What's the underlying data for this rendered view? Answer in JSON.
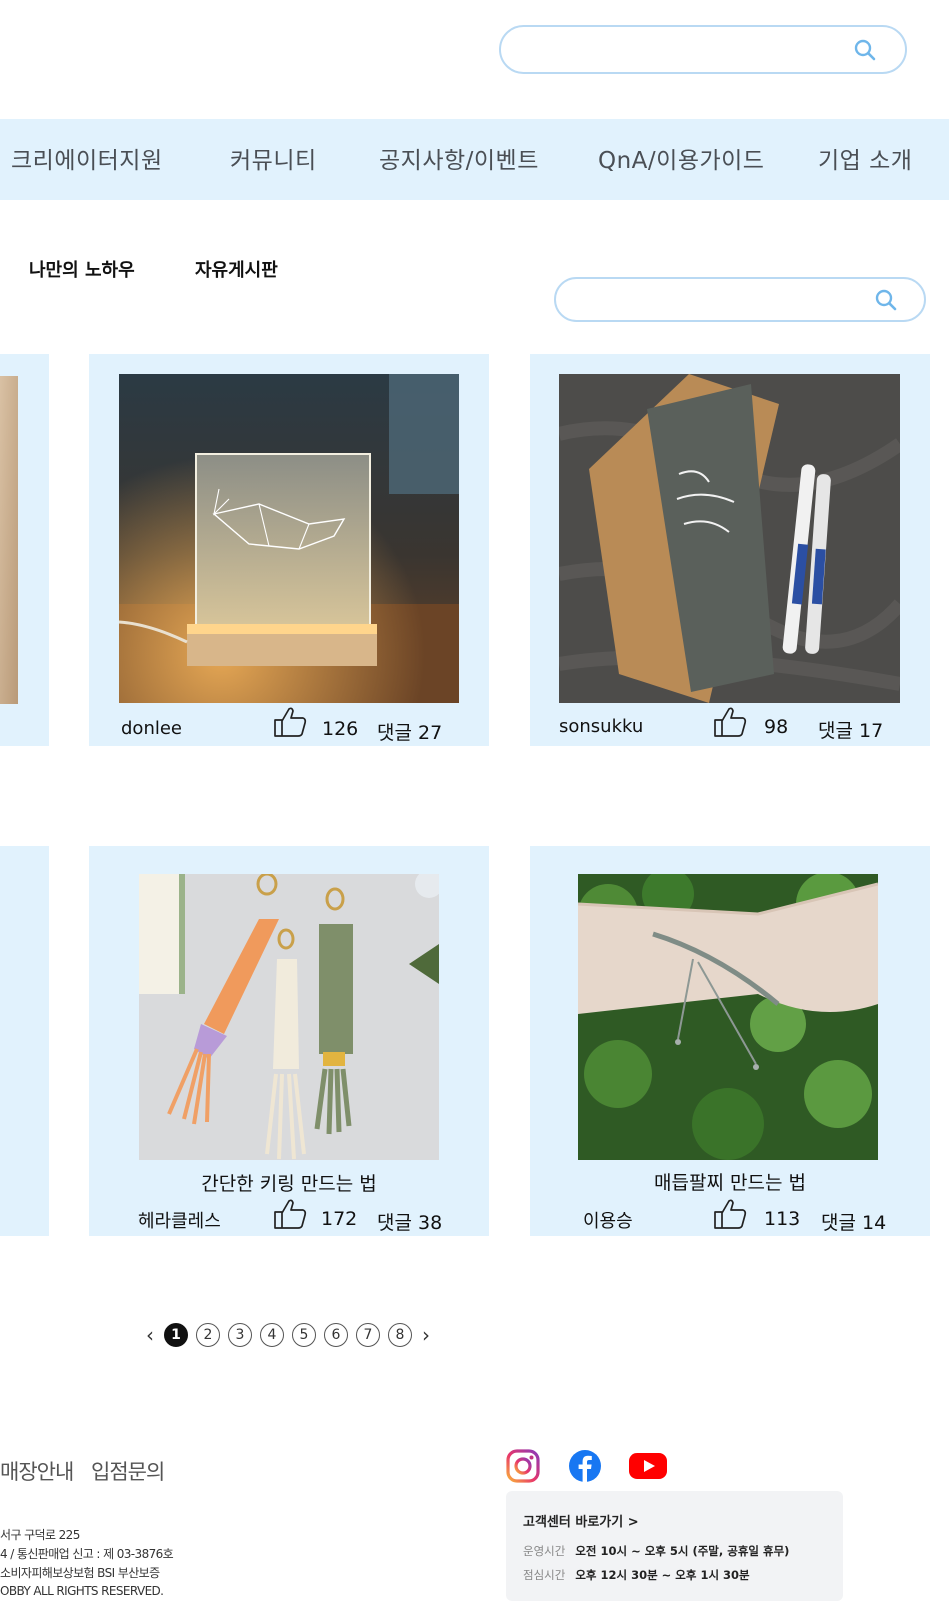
{
  "header": {
    "search": {
      "placeholder": ""
    }
  },
  "nav": {
    "items": [
      "크리에이터지원",
      "커뮤니티",
      "공지사항/이벤트",
      "QnA/이용가이드",
      "기업 소개"
    ]
  },
  "board": {
    "tabs": [
      "나만의 노하우",
      "자유게시판"
    ],
    "search": {
      "placeholder": ""
    }
  },
  "posts": [
    {
      "title": "",
      "author": "donlee",
      "likes": "126",
      "comments": "댓글 27",
      "image": "acrylic-whale-lamp"
    },
    {
      "title": "",
      "author": "sonsukku",
      "likes": "98",
      "comments": "댓글 17",
      "image": "calligraphy-card-markers"
    },
    {
      "title": "간단한 키링 만드는 법",
      "author": "헤라클레스",
      "likes": "172",
      "comments": "댓글 38",
      "image": "macrame-keyrings"
    },
    {
      "title": "매듭팔찌 만드는 법",
      "author": "이용승",
      "likes": "113",
      "comments": "댓글 14",
      "image": "knotted-bracelet"
    }
  ],
  "pagination": {
    "prev": "‹",
    "next": "›",
    "pages": [
      "1",
      "2",
      "3",
      "4",
      "5",
      "6",
      "7",
      "8"
    ],
    "current": "1"
  },
  "footer": {
    "links": [
      "매장안내",
      "입점문의"
    ],
    "info_lines": [
      "서구 구덕로 225",
      "4 / 통신판매업 신고 : 제 03-3876호",
      "소비자피해보상보험 BSI 부산보증",
      "OBBY ALL RIGHTS RESERVED."
    ],
    "social": [
      "instagram-icon",
      "facebook-icon",
      "youtube-icon"
    ],
    "cs": {
      "title": "고객센터 바로가기 >",
      "hours_label": "운영시간",
      "hours_value": "오전 10시 ~ 오후 5시 (주말, 공휴일 휴무)",
      "lunch_label": "점심시간",
      "lunch_value": "오후 12시 30분 ~ 오후 1시 30분"
    }
  },
  "colors": {
    "accent_light": "#e1f2fd",
    "search_border": "#b9d9f3",
    "search_icon": "#6fb6ea"
  }
}
